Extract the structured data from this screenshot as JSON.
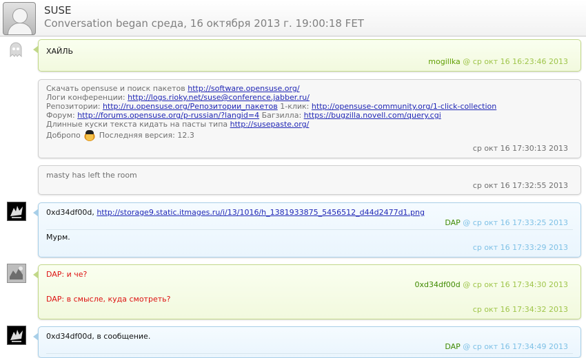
{
  "header": {
    "title": "SUSE",
    "subtitle": "Conversation began среда, 16 октября 2013 г. 19:00:18 FET"
  },
  "messages": [
    {
      "text": "ХАЙЛЬ",
      "nick": "mogillka",
      "sep": "@",
      "time": "ср окт 16 16:23:46 2013"
    },
    {
      "lines": [
        {
          "label": "Скачать opensuse и поиск пакетов",
          "link": "http://software.opensuse.org/"
        },
        {
          "label": "Логи конференции:",
          "link": "http://logs.rioky.net/suse@conference.jabber.ru/"
        },
        {
          "label": "Репозитории:",
          "link": "http://ru.opensuse.org/Репозитории_пакетов",
          "label2": "1-клик:",
          "link2": "http://opensuse-community.org/1-click-collection"
        },
        {
          "label": "Форум:",
          "link": "http://forums.opensuse.org/p-russian/?langid=4",
          "label2": "Багзилла:",
          "link2": "https://bugzilla.novell.com/query.cgi"
        },
        {
          "label": "Длинные куски текста кидать на пасты типа",
          "link": "http://susepaste.org/"
        },
        {
          "label": "Добропо",
          "label2": "Последняя версия: 12.3"
        }
      ],
      "time": "ср окт 16 17:30:13 2013"
    },
    {
      "text": "masty has left the room",
      "time": "ср окт 16 17:32:55 2013"
    },
    {
      "text_prefix": "0xd34df00d,",
      "link": "http://storage9.static.itmages.ru/i/13/1016/h_1381933875_5456512_d44d2477d1.png",
      "nick": "DAP",
      "sep": "@",
      "time": "ср окт 16 17:33:25 2013",
      "text2": "Мурм.",
      "time2": "ср окт 16 17:33:29 2013"
    },
    {
      "text": "DAP: и че?",
      "nick": "0xd34df00d",
      "sep": "@",
      "time": "ср окт 16 17:34:30 2013",
      "text2": "DAP: в смысле, куда смотреть?",
      "time2": "ср окт 16 17:34:32 2013"
    },
    {
      "text": "0xd34df00d, в сообщение.",
      "nick": "DAP",
      "sep": "@",
      "time": "ср окт 16 17:34:49 2013"
    }
  ]
}
